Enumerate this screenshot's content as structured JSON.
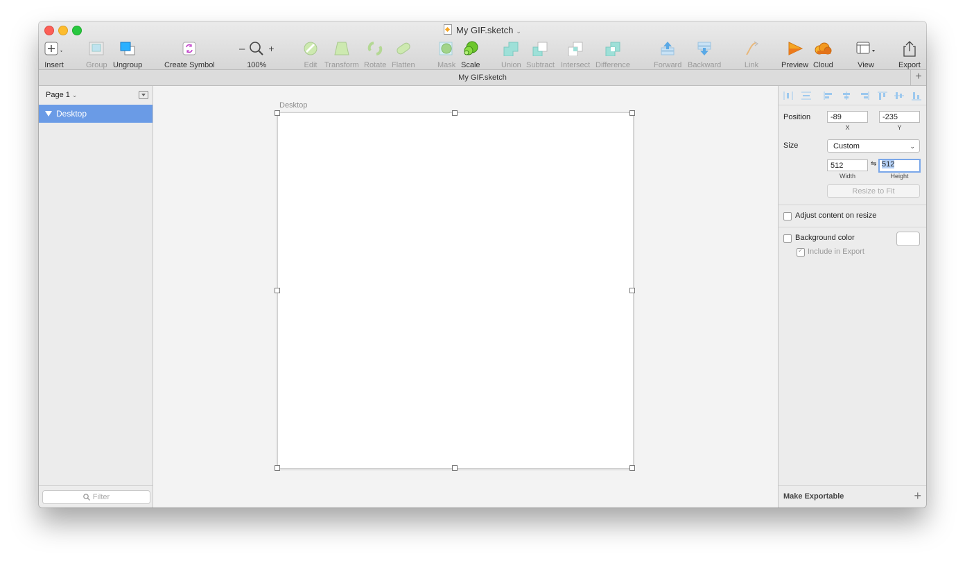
{
  "window": {
    "title": "My GIF.sketch",
    "tab_label": "My GIF.sketch"
  },
  "toolbar": {
    "insert": "Insert",
    "group": "Group",
    "ungroup": "Ungroup",
    "create_symbol": "Create Symbol",
    "zoom_minus": "–",
    "zoom_plus": "+",
    "zoom_level": "100%",
    "edit": "Edit",
    "transform": "Transform",
    "rotate": "Rotate",
    "flatten": "Flatten",
    "mask": "Mask",
    "scale": "Scale",
    "union": "Union",
    "subtract": "Subtract",
    "intersect": "Intersect",
    "difference": "Difference",
    "forward": "Forward",
    "backward": "Backward",
    "link": "Link",
    "preview": "Preview",
    "cloud": "Cloud",
    "view": "View",
    "export": "Export"
  },
  "left_panel": {
    "page_selector": "Page 1",
    "layers": [
      {
        "name": "Desktop",
        "selected": true
      }
    ],
    "filter_placeholder": "Filter"
  },
  "canvas": {
    "artboard_name": "Desktop"
  },
  "inspector": {
    "position_label": "Position",
    "x_value": "-89",
    "x_label": "X",
    "y_value": "-235",
    "y_label": "Y",
    "size_label": "Size",
    "size_preset": "Custom",
    "width_value": "512",
    "width_label": "Width",
    "height_value": "512",
    "height_label": "Height",
    "lock_symbol": "⇋",
    "resize_to_fit": "Resize to Fit",
    "adjust_content": "Adjust content on resize",
    "background_color": "Background color",
    "include_in_export": "Include in Export",
    "make_exportable": "Make Exportable",
    "add_symbol": "+"
  },
  "colors": {
    "selection_blue": "#6a9be6",
    "canvas_bg": "#f3f3f3",
    "preview_orange": "#f5a623"
  }
}
